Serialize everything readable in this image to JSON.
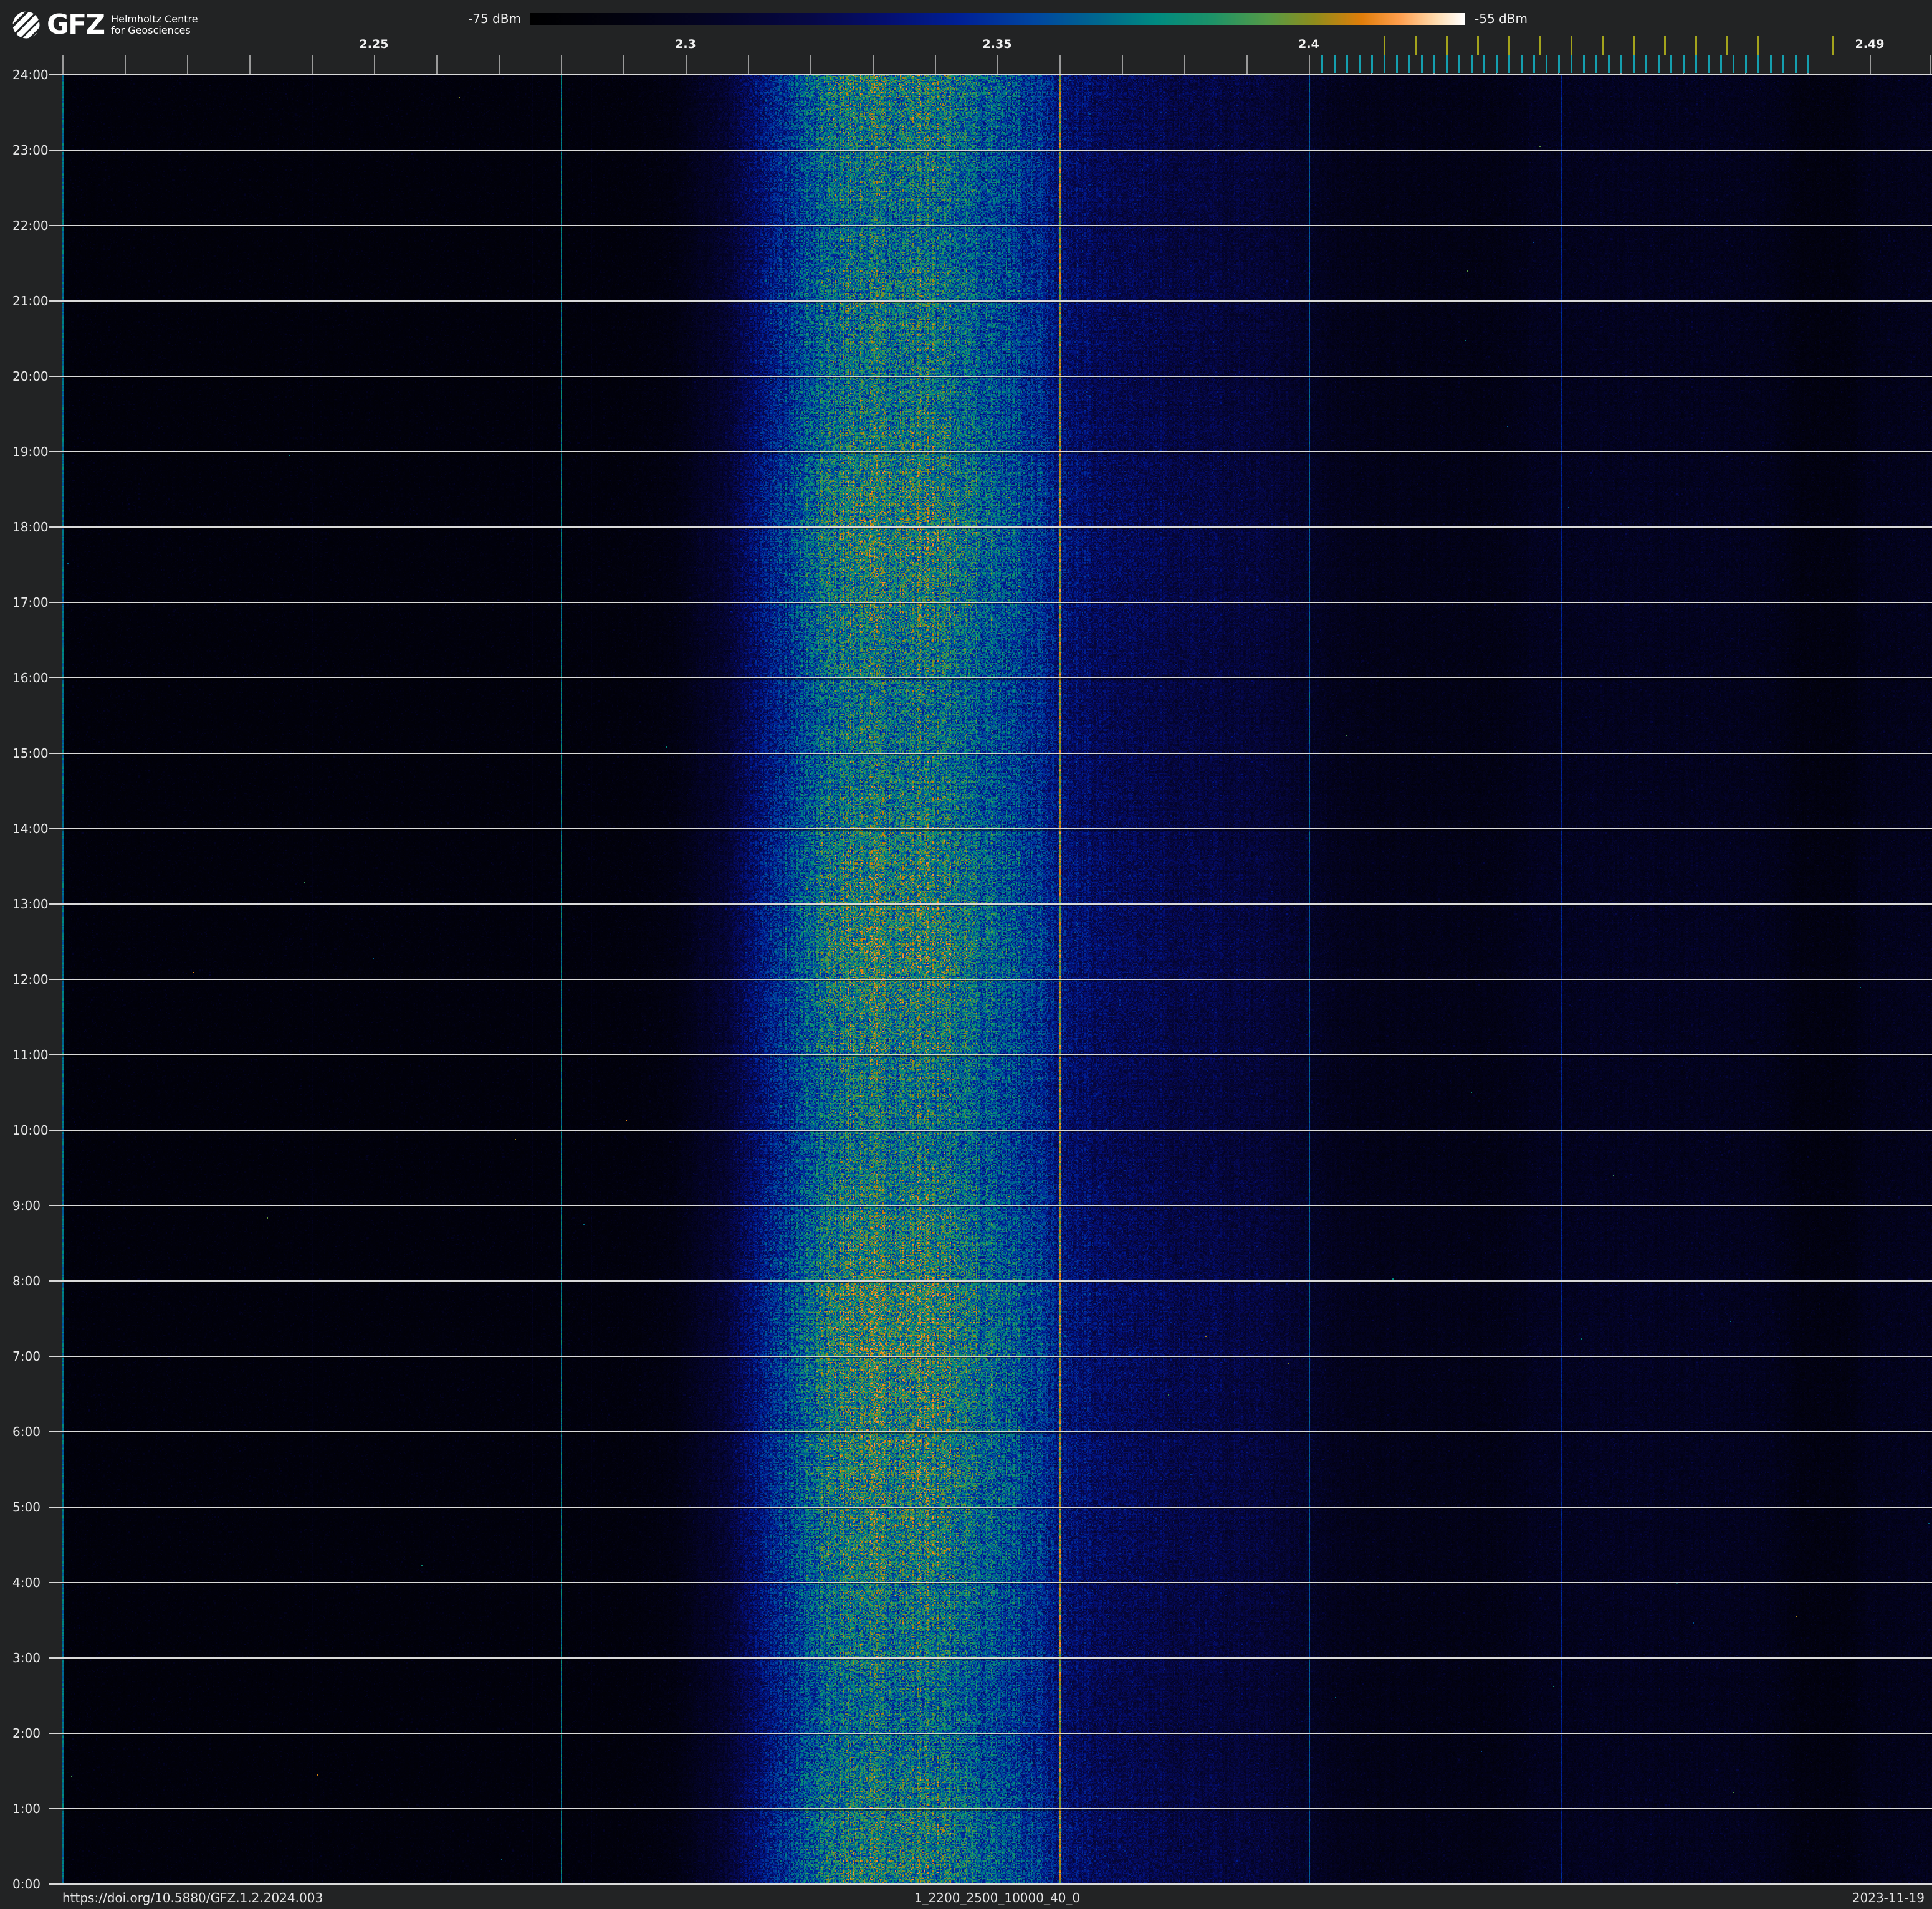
{
  "header": {
    "logo": {
      "acronym": "GFZ",
      "subtitle_line1": "Helmholtz Centre",
      "subtitle_line2": "for Geosciences"
    },
    "colorbar": {
      "min_label": "-75 dBm",
      "max_label": "-55 dBm"
    }
  },
  "footer": {
    "doi": "https://doi.org/10.5880/GFZ.1.2.2024.003",
    "dataset_id": "1_2200_2500_10000_40_0",
    "date": "2023-11-19"
  },
  "chart_data": {
    "type": "heatmap",
    "title": "24-hour radio-frequency waterfall spectrogram, 2.2-2.5 GHz",
    "x_axis": {
      "unit": "GHz",
      "min": 2.2,
      "max": 2.5,
      "labeled_ticks": [
        {
          "label": "2.25",
          "ghz": 2.25
        },
        {
          "label": "2.3",
          "ghz": 2.3
        },
        {
          "label": "2.35",
          "ghz": 2.35
        },
        {
          "label": "2.4",
          "ghz": 2.4
        },
        {
          "label": "2.49",
          "ghz": 2.49
        }
      ],
      "minor_ticks": {
        "start_ghz": 2.2,
        "step_ghz": 0.01,
        "count": 31
      }
    },
    "y_axis": {
      "unit": "time of day",
      "top": "24:00",
      "bottom": "0:00",
      "hour_labels": [
        "24:00",
        "23:00",
        "22:00",
        "21:00",
        "20:00",
        "19:00",
        "18:00",
        "17:00",
        "16:00",
        "15:00",
        "14:00",
        "13:00",
        "12:00",
        "11:00",
        "10:00",
        "9:00",
        "8:00",
        "7:00",
        "6:00",
        "5:00",
        "4:00",
        "3:00",
        "2:00",
        "1:00",
        "0:00"
      ]
    },
    "intensity_scale": {
      "unit": "dBm",
      "min": -75,
      "max": -55,
      "colormap_stops": [
        {
          "pos": 0.0,
          "color": "#000000"
        },
        {
          "pos": 0.1,
          "color": "#02020f"
        },
        {
          "pos": 0.2,
          "color": "#040426"
        },
        {
          "pos": 0.3,
          "color": "#060845"
        },
        {
          "pos": 0.38,
          "color": "#040e6e"
        },
        {
          "pos": 0.46,
          "color": "#002096"
        },
        {
          "pos": 0.54,
          "color": "#0046a0"
        },
        {
          "pos": 0.61,
          "color": "#00688e"
        },
        {
          "pos": 0.67,
          "color": "#008a80"
        },
        {
          "pos": 0.73,
          "color": "#1d9268"
        },
        {
          "pos": 0.79,
          "color": "#559a46"
        },
        {
          "pos": 0.84,
          "color": "#8f8c1c"
        },
        {
          "pos": 0.89,
          "color": "#e07d0a"
        },
        {
          "pos": 0.93,
          "color": "#ff9e4d"
        },
        {
          "pos": 0.97,
          "color": "#ffdcb0"
        },
        {
          "pos": 1.0,
          "color": "#ffffff"
        }
      ]
    },
    "wifi_channel_markers_mhz": [
      2412,
      2417,
      2422,
      2427,
      2432,
      2437,
      2442,
      2447,
      2452,
      2457,
      2462,
      2467,
      2472,
      2484
    ],
    "ble_channel_markers_mhz": [
      2402,
      2404,
      2406,
      2408,
      2410,
      2412,
      2414,
      2416,
      2418,
      2420,
      2422,
      2424,
      2426,
      2428,
      2430,
      2432,
      2434,
      2436,
      2438,
      2440,
      2442,
      2444,
      2446,
      2448,
      2450,
      2452,
      2454,
      2456,
      2458,
      2460,
      2462,
      2464,
      2466,
      2468,
      2470,
      2472,
      2474,
      2476,
      2478,
      2480
    ],
    "frequency_profile": [
      [
        2.2,
        0.05
      ],
      [
        2.24,
        0.05
      ],
      [
        2.29,
        0.06
      ],
      [
        2.298,
        0.09
      ],
      [
        2.306,
        0.22
      ],
      [
        2.314,
        0.46
      ],
      [
        2.32,
        0.62
      ],
      [
        2.326,
        0.71
      ],
      [
        2.332,
        0.73
      ],
      [
        2.34,
        0.71
      ],
      [
        2.348,
        0.63
      ],
      [
        2.356,
        0.52
      ],
      [
        2.361,
        0.4
      ],
      [
        2.366,
        0.35
      ],
      [
        2.374,
        0.31
      ],
      [
        2.384,
        0.28
      ],
      [
        2.392,
        0.25
      ],
      [
        2.399,
        0.2
      ],
      [
        2.404,
        0.15
      ],
      [
        2.41,
        0.12
      ],
      [
        2.43,
        0.11
      ],
      [
        2.437,
        0.15
      ],
      [
        2.452,
        0.16
      ],
      [
        2.468,
        0.15
      ],
      [
        2.475,
        0.13
      ],
      [
        2.479,
        0.085
      ],
      [
        2.486,
        0.085
      ],
      [
        2.49,
        0.13
      ],
      [
        2.5,
        0.14
      ]
    ],
    "hourly_intensity": [
      0.95,
      0.9,
      0.86,
      0.9,
      0.88,
      0.92,
      0.97,
      0.94,
      0.89,
      0.88,
      0.92,
      0.97,
      0.97,
      0.92,
      0.89,
      0.93,
      1.0,
      1.0,
      0.97,
      0.96,
      0.92,
      0.88,
      0.85,
      0.93
    ],
    "carrier_lines": [
      {
        "ghz": 2.2,
        "level": 0.62
      },
      {
        "ghz": 2.28,
        "level": 0.64
      },
      {
        "ghz": 2.36,
        "level": 0.84
      },
      {
        "ghz": 2.4,
        "level": 0.58
      },
      {
        "ghz": 2.4404,
        "level": 0.46
      }
    ],
    "faint_lines": [
      {
        "ghz": 2.24,
        "bump": 0.04
      },
      {
        "ghz": 2.2755,
        "bump": 0.05
      },
      {
        "ghz": 2.2848,
        "bump": 0.05
      }
    ],
    "quiet_band_ghz": [
      2.479,
      2.486
    ],
    "grid": {
      "hour_line_color": "#d9d9d9",
      "minor_tick_color": "#9a9a9a",
      "wifi_tick_color": "#a3a31c",
      "ble_tick_color": "#159fae"
    }
  }
}
